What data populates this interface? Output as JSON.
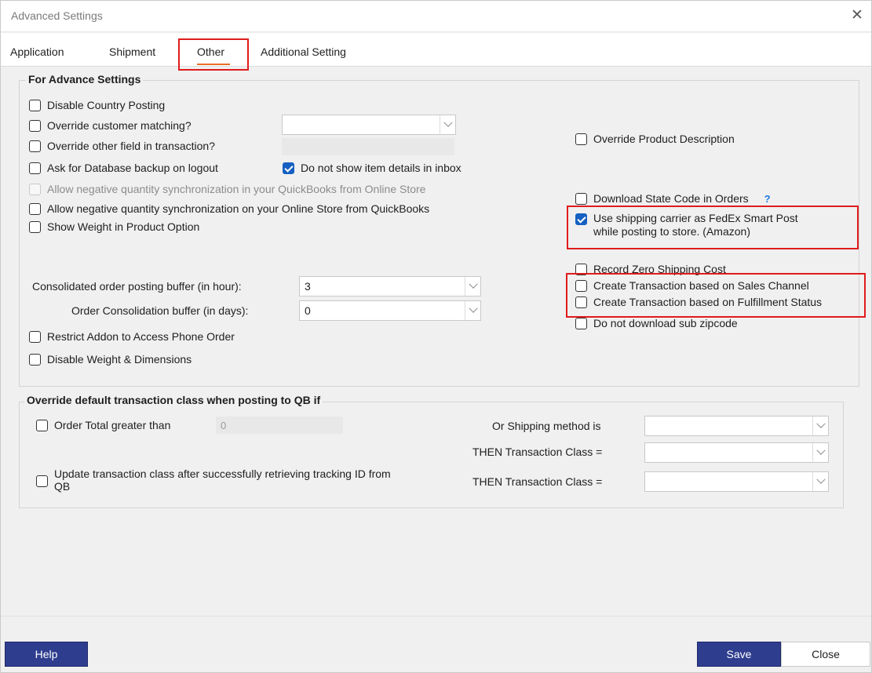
{
  "window": {
    "title": "Advanced Settings",
    "close_icon": "close-icon"
  },
  "tabs": [
    {
      "label": "Application"
    },
    {
      "label": "Shipment"
    },
    {
      "label": "Other",
      "selected": true
    },
    {
      "label": "Additional Setting"
    }
  ],
  "advance": {
    "legend": "For Advance Settings",
    "disable_country_posting": {
      "label": "Disable Country Posting",
      "checked": false
    },
    "override_customer_matching": {
      "label": "Override customer matching?",
      "checked": false,
      "value": ""
    },
    "override_other_field": {
      "label": "Override other field in transaction?",
      "checked": false,
      "value": ""
    },
    "ask_backup": {
      "label": "Ask for Database backup on logout",
      "checked": false
    },
    "no_item_details": {
      "label": "Do not show item details in inbox",
      "checked": true
    },
    "allow_neg_qb": {
      "label": "Allow negative quantity synchronization in your QuickBooks from  Online Store",
      "checked": false,
      "disabled": true
    },
    "allow_neg_store": {
      "label": "Allow negative quantity synchronization on your Online Store from QuickBooks",
      "checked": false
    },
    "show_weight": {
      "label": "Show Weight in Product Option",
      "checked": false
    },
    "consolidated_hour": {
      "label": "Consolidated order posting buffer (in hour):",
      "value": "3"
    },
    "consolidation_days": {
      "label": "Order Consolidation buffer (in days):",
      "value": "0"
    },
    "restrict_addon": {
      "label": "Restrict Addon to Access Phone Order",
      "checked": false
    },
    "disable_weight": {
      "label": "Disable Weight & Dimensions",
      "checked": false
    },
    "override_product_desc": {
      "label": "Override Product Description",
      "checked": false
    },
    "download_state_code": {
      "label": "Download State Code in Orders",
      "checked": false,
      "help": "?"
    },
    "fedex_smart_post": {
      "label_line1": "Use shipping carrier as FedEx Smart Post",
      "label_line2": "while posting to store. (Amazon)",
      "checked": true
    },
    "record_zero_shipping": {
      "label": "Record Zero Shipping Cost",
      "checked": false
    },
    "txn_sales_channel": {
      "label": "Create Transaction based on Sales Channel",
      "checked": false
    },
    "txn_fulfillment": {
      "label": "Create Transaction based on Fulfillment Status",
      "checked": false
    },
    "no_sub_zipcode": {
      "label": "Do not download sub zipcode",
      "checked": false
    }
  },
  "override_class": {
    "legend": "Override default transaction class when posting to QB if",
    "order_total": {
      "label": "Order Total greater than",
      "checked": false,
      "value": "0"
    },
    "update_class": {
      "label_line1": "Update transaction class after successfully retrieving tracking ID from",
      "label_line2": "QB",
      "checked": false
    },
    "shipping_method_label": "Or Shipping method is",
    "then_class_label_1": "THEN Transaction Class =",
    "then_class_label_2": "THEN Transaction Class =",
    "shipping_method_value": "",
    "then_class_value_1": "",
    "then_class_value_2": ""
  },
  "buttons": {
    "help": "Help",
    "save": "Save",
    "close": "Close"
  },
  "colors": {
    "primary_button": "#2f3d8f",
    "checkbox_checked": "#1560c2",
    "highlight": "#e01b1b",
    "tab_accent": "#e8702a"
  }
}
